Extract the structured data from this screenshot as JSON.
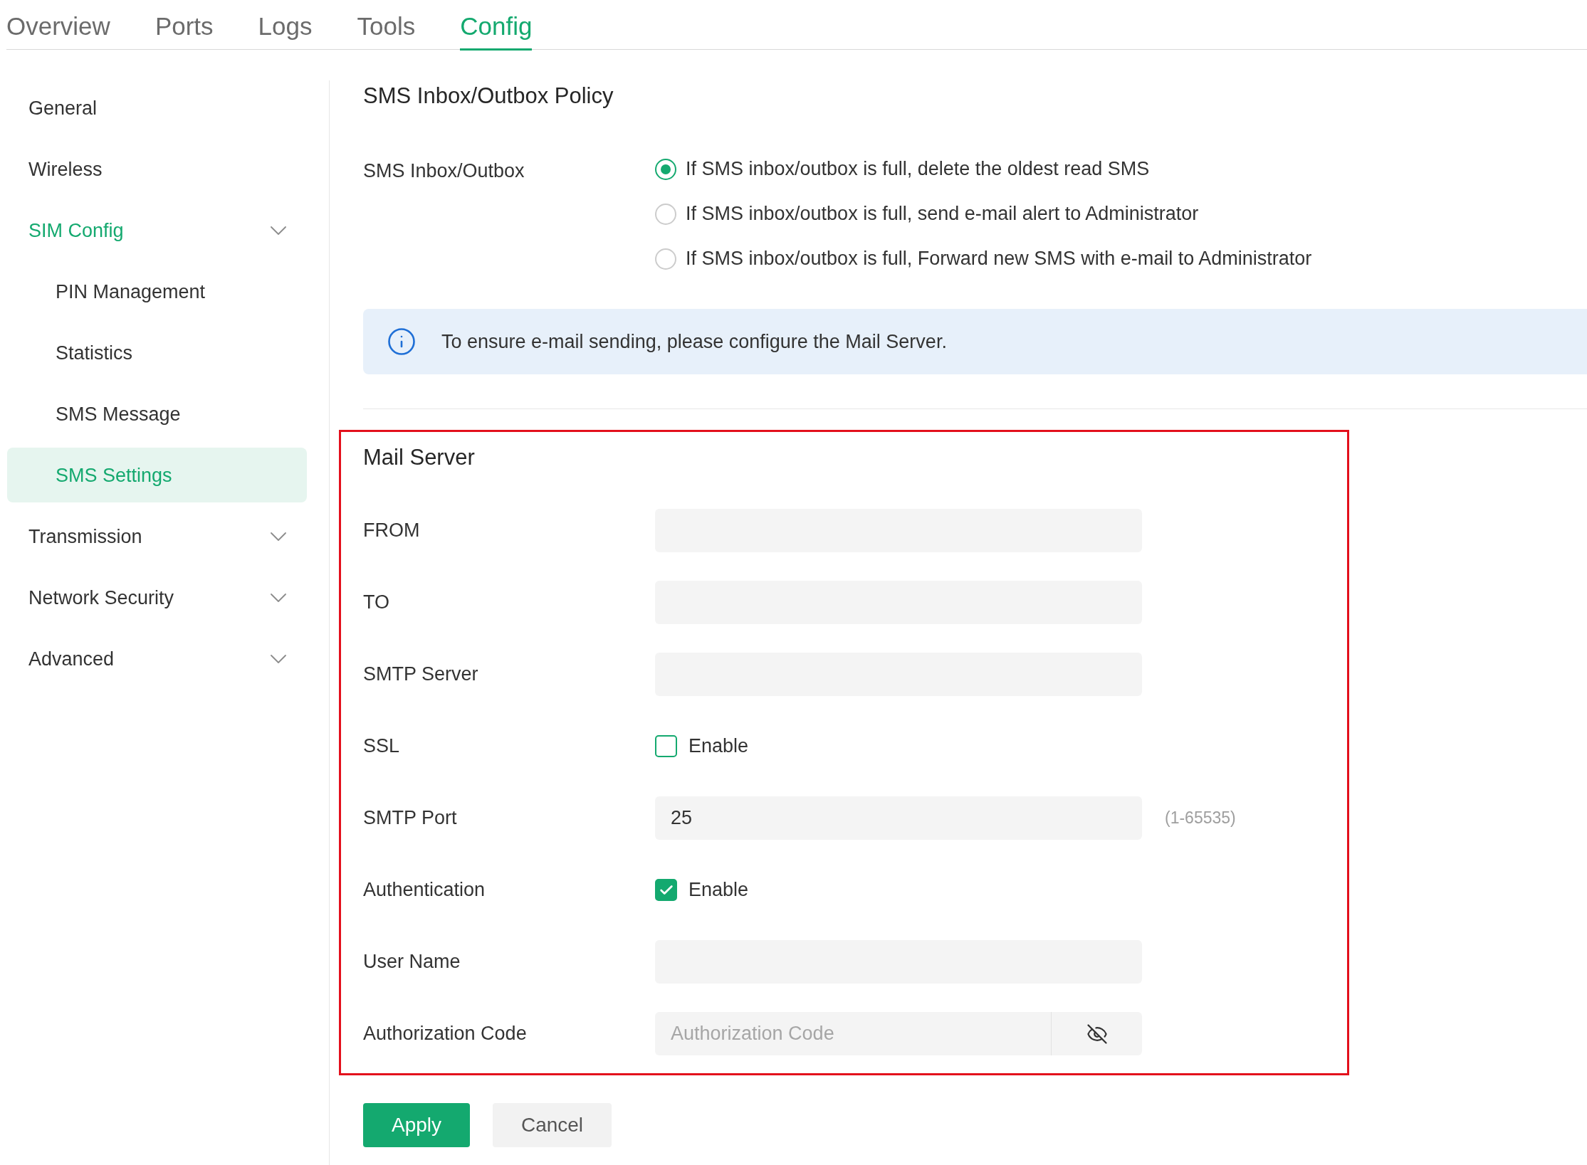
{
  "tabs": [
    {
      "label": "Overview",
      "selected": false
    },
    {
      "label": "Ports",
      "selected": false
    },
    {
      "label": "Logs",
      "selected": false
    },
    {
      "label": "Tools",
      "selected": false
    },
    {
      "label": "Config",
      "selected": true
    }
  ],
  "sidebar": {
    "items": [
      {
        "kind": "link",
        "label": "General",
        "selected": false
      },
      {
        "kind": "link",
        "label": "Wireless",
        "selected": false
      },
      {
        "kind": "group",
        "label": "SIM Config",
        "selected": false,
        "children": [
          {
            "label": "PIN Management",
            "selected": false
          },
          {
            "label": "Statistics",
            "selected": false
          },
          {
            "label": "SMS Message",
            "selected": false
          },
          {
            "label": "SMS Settings",
            "selected": true
          }
        ]
      },
      {
        "kind": "group",
        "label": "Transmission",
        "selected": false
      },
      {
        "kind": "group",
        "label": "Network Security",
        "selected": false
      },
      {
        "kind": "group",
        "label": "Advanced",
        "selected": false
      }
    ]
  },
  "sms_policy": {
    "title": "SMS Inbox/Outbox Policy",
    "label": "SMS Inbox/Outbox",
    "options": [
      {
        "label": "If SMS inbox/outbox is full, delete the oldest read SMS",
        "selected": true
      },
      {
        "label": "If SMS inbox/outbox is full, send e-mail alert to Administrator",
        "selected": false
      },
      {
        "label": "If SMS inbox/outbox is full, Forward new SMS with e-mail to Administrator",
        "selected": false
      }
    ]
  },
  "info_banner": {
    "text": "To ensure e-mail sending, please configure the Mail Server."
  },
  "mail_server": {
    "title": "Mail Server",
    "highlighted": true,
    "fields": [
      {
        "kind": "input",
        "label": "FROM"
      },
      {
        "kind": "input",
        "label": "TO"
      },
      {
        "kind": "input",
        "label": "SMTP Server"
      },
      {
        "kind": "checkbox",
        "label": "SSL",
        "option": "Enable",
        "checked": false
      },
      {
        "kind": "input",
        "label": "SMTP Port",
        "value": "25",
        "hint": "(1-65535)"
      },
      {
        "kind": "checkbox",
        "label": "Authentication",
        "option": "Enable",
        "checked": true
      },
      {
        "kind": "input",
        "label": "User Name"
      },
      {
        "kind": "password",
        "label": "Authorization Code",
        "placeholder": "Authorization Code"
      }
    ]
  },
  "buttons": [
    {
      "kind": "primary",
      "label": "Apply"
    },
    {
      "kind": "secondary",
      "label": "Cancel"
    }
  ]
}
